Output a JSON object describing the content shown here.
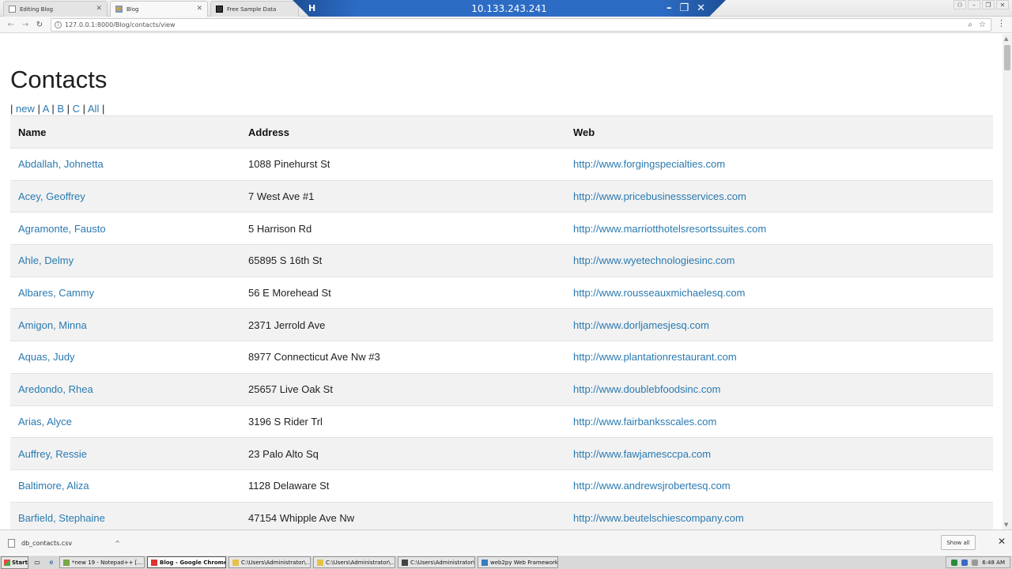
{
  "browser": {
    "tabs": [
      {
        "title": "Editing Blog",
        "active": false
      },
      {
        "title": "Blog",
        "active": true
      },
      {
        "title": "Free Sample Data",
        "active": false
      }
    ],
    "url": "127.0.0.1:8000/Blog/contacts/view"
  },
  "remote": {
    "ip": "10.133.243.241",
    "minimize": "–",
    "restore": "❐",
    "close": "✕"
  },
  "page": {
    "title": "Contacts",
    "filters": {
      "new": "new",
      "a": "A",
      "b": "B",
      "c": "C",
      "all": "All"
    },
    "columns": {
      "name": "Name",
      "address": "Address",
      "web": "Web"
    },
    "rows": [
      {
        "name": "Abdallah, Johnetta",
        "address": "1088 Pinehurst St",
        "web": "http://www.forgingspecialties.com"
      },
      {
        "name": "Acey, Geoffrey",
        "address": "7 West Ave #1",
        "web": "http://www.pricebusinessservices.com"
      },
      {
        "name": "Agramonte, Fausto",
        "address": "5 Harrison Rd",
        "web": "http://www.marriotthotelsresortssuites.com"
      },
      {
        "name": "Ahle, Delmy",
        "address": "65895 S 16th St",
        "web": "http://www.wyetechnologiesinc.com"
      },
      {
        "name": "Albares, Cammy",
        "address": "56 E Morehead St",
        "web": "http://www.rousseauxmichaelesq.com"
      },
      {
        "name": "Amigon, Minna",
        "address": "2371 Jerrold Ave",
        "web": "http://www.dorljamesjesq.com"
      },
      {
        "name": "Aquas, Judy",
        "address": "8977 Connecticut Ave Nw #3",
        "web": "http://www.plantationrestaurant.com"
      },
      {
        "name": "Aredondo, Rhea",
        "address": "25657 Live Oak St",
        "web": "http://www.doublebfoodsinc.com"
      },
      {
        "name": "Arias, Alyce",
        "address": "3196 S Rider Trl",
        "web": "http://www.fairbanksscales.com"
      },
      {
        "name": "Auffrey, Ressie",
        "address": "23 Palo Alto Sq",
        "web": "http://www.fawjamesccpa.com"
      },
      {
        "name": "Baltimore, Aliza",
        "address": "1128 Delaware St",
        "web": "http://www.andrewsjrobertesq.com"
      },
      {
        "name": "Barfield, Stephaine",
        "address": "47154 Whipple Ave Nw",
        "web": "http://www.beutelschiescompany.com"
      }
    ]
  },
  "downloads": {
    "file": "db_contacts.csv",
    "show_all": "Show all"
  },
  "taskbar": {
    "start": "Start",
    "tasks": [
      {
        "label": "*new 19 - Notepad++ [...",
        "active": false
      },
      {
        "label": "Blog - Google Chrome",
        "active": true
      },
      {
        "label": "C:\\Users\\Administrator\\...",
        "active": false
      },
      {
        "label": "C:\\Users\\Administrator\\...",
        "active": false
      },
      {
        "label": "C:\\Users\\Administrator\\...",
        "active": false
      },
      {
        "label": "web2py Web Framework",
        "active": false
      }
    ],
    "clock": "6:48 AM"
  }
}
